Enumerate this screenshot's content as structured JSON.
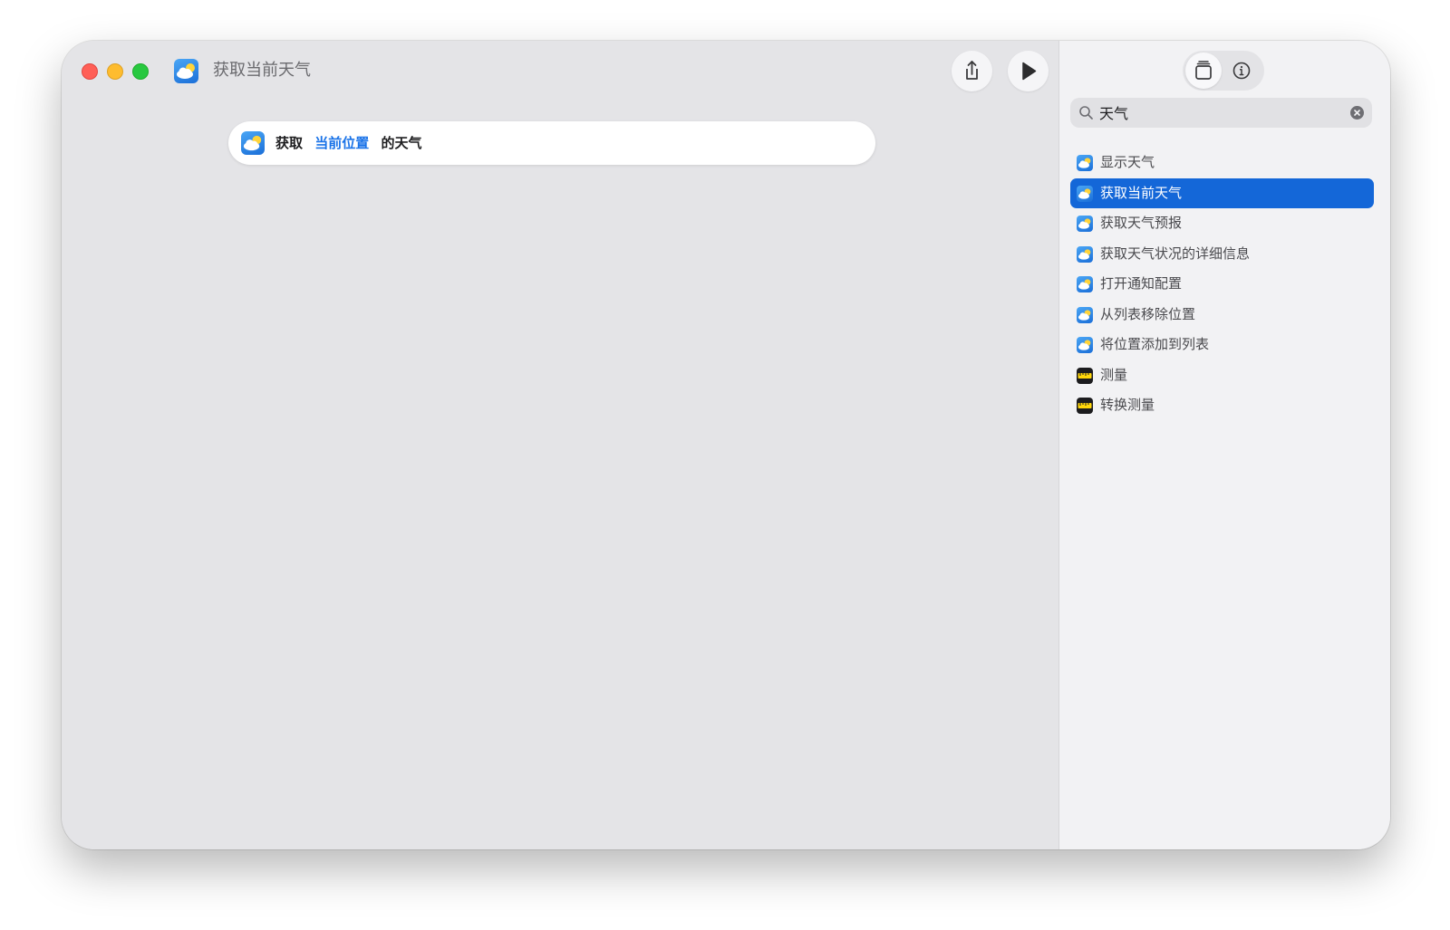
{
  "window": {
    "title": "获取当前天气",
    "app_icon": "weather-icon"
  },
  "toolbar": {
    "share_icon": "share-icon",
    "run_icon": "play-icon"
  },
  "action": {
    "verb": "获取",
    "token": "当前位置",
    "suffix": "的天气"
  },
  "sidebar": {
    "tabs": {
      "library_icon": "library-icon",
      "info_icon": "info-icon"
    },
    "search": {
      "value": "天气"
    },
    "results": [
      {
        "label": "显示天气",
        "icon": "weather-icon",
        "selected": false
      },
      {
        "label": "获取当前天气",
        "icon": "weather-icon",
        "selected": true
      },
      {
        "label": "获取天气预报",
        "icon": "weather-icon",
        "selected": false
      },
      {
        "label": "获取天气状况的详细信息",
        "icon": "weather-icon",
        "selected": false
      },
      {
        "label": "打开通知配置",
        "icon": "weather-icon",
        "selected": false
      },
      {
        "label": "从列表移除位置",
        "icon": "weather-icon",
        "selected": false
      },
      {
        "label": "将位置添加到列表",
        "icon": "weather-icon",
        "selected": false
      },
      {
        "label": "测量",
        "icon": "measure-icon",
        "selected": false
      },
      {
        "label": "转换测量",
        "icon": "measure-icon",
        "selected": false
      }
    ]
  },
  "colors": {
    "accent": "#1467d8",
    "token_blue": "#1a73e8",
    "editor_bg": "#e4e4e7",
    "sidebar_bg": "#f2f2f4"
  }
}
